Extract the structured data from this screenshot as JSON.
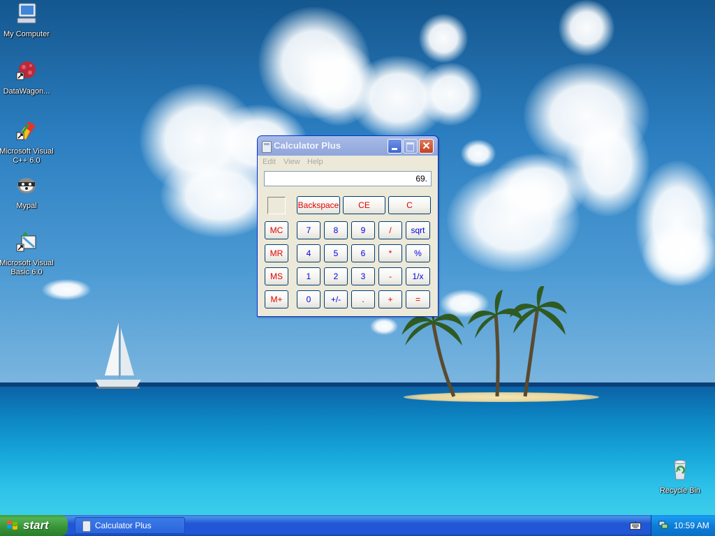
{
  "desktop": {
    "icons": [
      {
        "label": "My Computer",
        "icon": "my-computer-icon"
      },
      {
        "label": "DataWagon...",
        "icon": "datawagon-icon"
      },
      {
        "label": "Microsoft Visual C++ 6.0",
        "icon": "visual-cpp-icon"
      },
      {
        "label": "Mypal",
        "icon": "mypal-icon"
      },
      {
        "label": "Microsoft Visual Basic 6.0",
        "icon": "visual-basic-icon"
      },
      {
        "label": "Recycle Bin",
        "icon": "recycle-bin-icon"
      }
    ]
  },
  "calculator": {
    "title": "Calculator Plus",
    "close_glyph": "✕",
    "menu": [
      "Edit",
      "View",
      "Help"
    ],
    "display": "69.",
    "keys": {
      "backspace": "Backspace",
      "ce": "CE",
      "c": "C",
      "mc": "MC",
      "mr": "MR",
      "ms": "MS",
      "mplus": "M+",
      "n7": "7",
      "n8": "8",
      "n9": "9",
      "div": "/",
      "sqrt": "sqrt",
      "n4": "4",
      "n5": "5",
      "n6": "6",
      "mul": "*",
      "pct": "%",
      "n1": "1",
      "n2": "2",
      "n3": "3",
      "sub": "-",
      "recip": "1/x",
      "n0": "0",
      "sign": "+/-",
      "dot": ".",
      "add": "+",
      "eq": "="
    }
  },
  "taskbar": {
    "start_label": "start",
    "tasks": [
      {
        "label": "Calculator Plus"
      }
    ],
    "clock": "10:59 AM"
  },
  "colors": {
    "title_bar": "#9db2e2",
    "key_red": "#e00000",
    "key_blue": "#0000e0",
    "taskbar": "#2157d7",
    "start_green": "#379337"
  }
}
